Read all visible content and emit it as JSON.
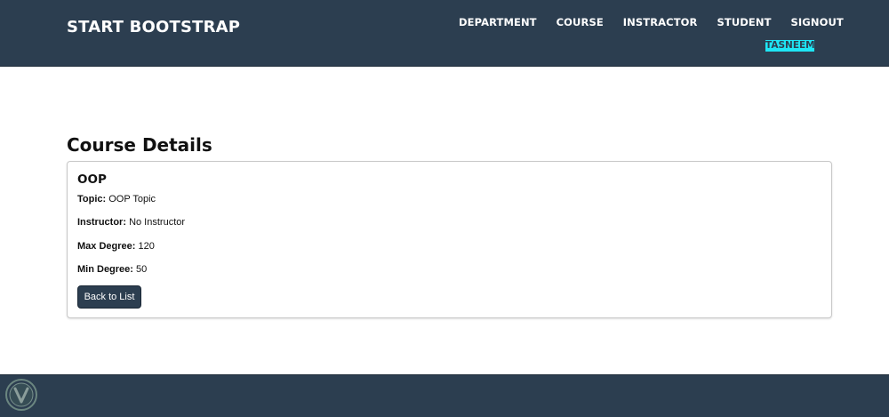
{
  "navbar": {
    "brand": "START BOOTSTRAP",
    "links": [
      "DEPARTMENT",
      "COURSE",
      "INSTRACTOR",
      "STUDENT",
      "SIGNOUT"
    ],
    "user": "TASNEEM"
  },
  "main": {
    "title": "Course Details",
    "course": {
      "name": "OOP",
      "fields": [
        {
          "label": "Topic:",
          "value": "OOP Topic"
        },
        {
          "label": "Instructor:",
          "value": "No Instructor"
        },
        {
          "label": "Max Degree:",
          "value": "120"
        },
        {
          "label": "Min Degree:",
          "value": "50"
        }
      ]
    },
    "back_button": "Back to List"
  },
  "colors": {
    "navbar_bg": "#2c3e50",
    "badge_bg": "#1ee6f5",
    "button_bg": "#2c3e50",
    "footer_bg": "#2c3e50"
  },
  "icons": {
    "watermark": "shield-logo-icon"
  }
}
